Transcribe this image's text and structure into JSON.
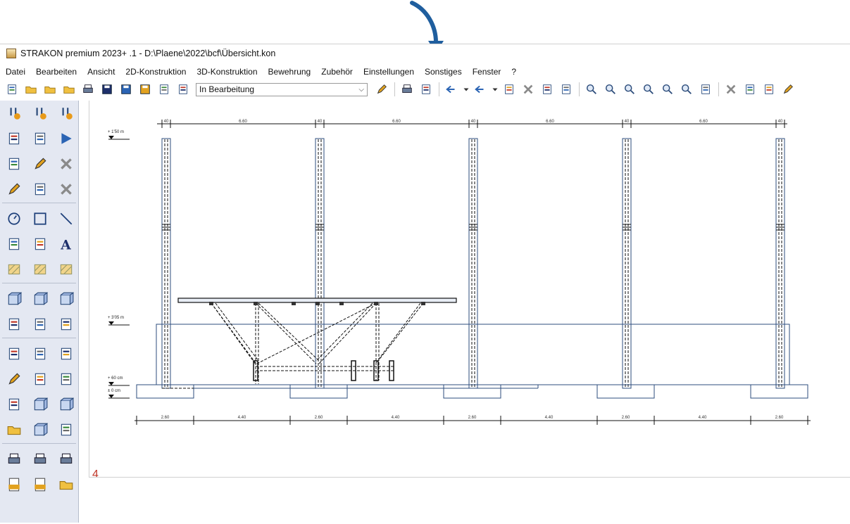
{
  "window": {
    "title": "STRAKON premium 2023+ .1 - D:\\Plaene\\2022\\bcf\\Übersicht.kon"
  },
  "menu": [
    "Datei",
    "Bearbeiten",
    "Ansicht",
    "2D-Konstruktion",
    "3D-Konstruktion",
    "Bewehrung",
    "Zubehör",
    "Einstellungen",
    "Sonstiges",
    "Fenster",
    "?"
  ],
  "toolbar": {
    "status_value": "In Bearbeitung",
    "icons_group1": [
      "new-file-icon",
      "open-folder-icon",
      "open-folder-alt-icon",
      "open-folder-user-icon",
      "print-preview-icon",
      "save-icon",
      "save-as-icon",
      "save-all-icon",
      "window-list-icon",
      "window-cascade-icon"
    ],
    "icons_group2": [
      "edit-note-icon"
    ],
    "icons_group3": [
      "print-icon",
      "pdf-export-icon"
    ],
    "icons_group4": [
      "undo-icon",
      "undo-dropdown-icon",
      "redo-icon",
      "redo-dropdown-icon",
      "cut-icon",
      "delete-cut-icon",
      "copy-icon",
      "paste-icon"
    ],
    "icons_group5": [
      "zoom-window-icon",
      "zoom-dynamic-icon",
      "zoom-all-icon",
      "zoom-in-icon",
      "zoom-out-icon",
      "zoom-previous-icon",
      "refresh-icon"
    ],
    "icons_group6": [
      "delete-elements-icon",
      "copy-elements-icon",
      "move-elements-icon",
      "edit-elements-icon"
    ]
  },
  "palette": {
    "groups": [
      [
        "level-1-icon",
        "level-2-icon",
        "level-3-icon",
        "layer-list-icon",
        "building-icon",
        "play-icon",
        "info-settings-icon",
        "edit-layers-icon",
        "tools-delete-icon",
        "pencil-icon",
        "measure-icon",
        "cross-delete-icon"
      ],
      [
        "circle-meter-icon",
        "rectangle-icon",
        "line-icon",
        "elevation-text-icon",
        "dimension-icon",
        "text-tool-icon",
        "hatch-lines-icon",
        "pattern-lines-icon",
        "fill-pattern-icon"
      ],
      [
        "grid-elements-icon",
        "cube-mesh-icon",
        "cube-wire-icon",
        "select-box-icon",
        "column-icon",
        "assembly-icon"
      ],
      [
        "doc-settings-icon",
        "rebar-doc-icon",
        "sheet-icon",
        "doc-edit-icon",
        "rebar-bend-icon",
        "diagonal-sheet-icon",
        "doc-pages-icon",
        "grid-cube-icon",
        "cube-list-icon",
        "list-folder-icon",
        "people-grid-icon",
        "list-item-icon"
      ],
      [
        "plot-icon",
        "scan-icon",
        "printer-icon",
        "dwg-export-icon",
        "dwg-import-icon",
        "folder-star-icon"
      ]
    ]
  },
  "drawing": {
    "level_labels": [
      "+ 1'50 m",
      "+ 3'05 m",
      "+ 60 cm",
      "± 0 cm"
    ],
    "top_dims": [
      "40",
      "6.60",
      "40",
      "6.60",
      "40",
      "6.60",
      "40",
      "6.60",
      "40"
    ],
    "bottom_dims": [
      "2.60",
      "4.40",
      "2.60",
      "4.40",
      "2.60",
      "4.40",
      "2.60",
      "4.40",
      "2.60"
    ],
    "sheet_number": "4"
  },
  "colors": {
    "structure": "#2e4e7e",
    "palette_bg": "#e4e8f2",
    "annotation_arrow": "#1f5e9e"
  }
}
